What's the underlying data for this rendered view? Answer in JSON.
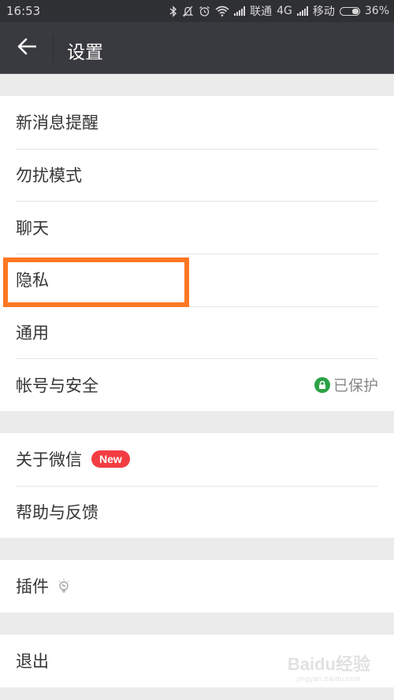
{
  "status_bar": {
    "time": "16:53",
    "carrier1": "联通",
    "network": "4G",
    "carrier2": "移动",
    "battery": "36%",
    "icons": [
      "bluetooth-icon",
      "mute-bell-icon",
      "alarm-icon",
      "wifi-icon",
      "signal-icon",
      "signal-icon",
      "battery-icon"
    ]
  },
  "header": {
    "back_icon": "arrow-left-icon",
    "title": "设置"
  },
  "groups": [
    {
      "items": [
        {
          "label": "新消息提醒"
        },
        {
          "label": "勿扰模式"
        },
        {
          "label": "聊天"
        },
        {
          "label": "隐私"
        },
        {
          "label": "通用"
        },
        {
          "label": "帐号与安全",
          "status": "已保护",
          "status_icon": "lock-icon"
        }
      ]
    },
    {
      "items": [
        {
          "label": "关于微信",
          "badge": "New"
        },
        {
          "label": "帮助与反馈"
        }
      ]
    },
    {
      "items": [
        {
          "label": "插件",
          "icon": "lightbulb-icon"
        }
      ]
    },
    {
      "items": [
        {
          "label": "退出"
        }
      ]
    }
  ],
  "highlight": {
    "target": "隐私",
    "color": "#ff7722"
  },
  "colors": {
    "status_bar_bg": "#2f3034",
    "title_bar_bg": "#393a3f",
    "badge_red": "#f33d43",
    "lock_green": "#2ba245"
  },
  "watermark": {
    "brand": "Baidu经验",
    "url": "jingyan.baidu.com"
  }
}
